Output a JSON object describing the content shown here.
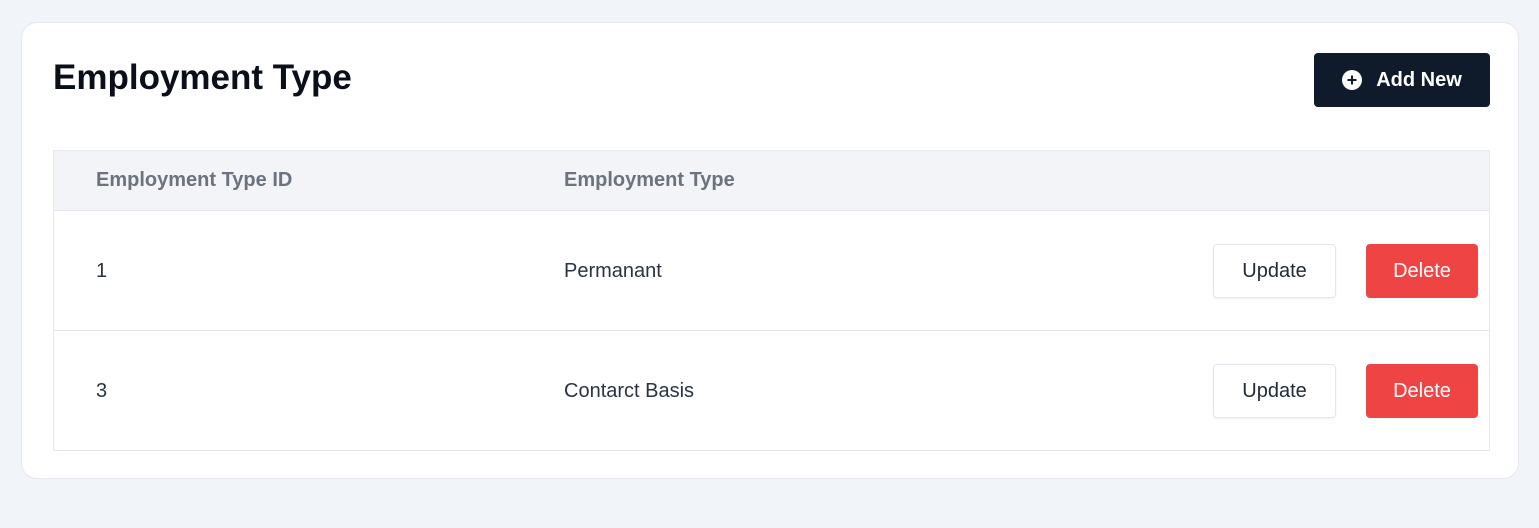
{
  "page": {
    "title": "Employment Type",
    "add_button_label": "Add New",
    "add_button_icon": "plus-circle-icon"
  },
  "colors": {
    "background": "#f1f4f8",
    "primary_button": "#0f1b2a",
    "delete_button": "#ef4444",
    "header_bg": "#f3f4f7"
  },
  "table": {
    "columns": [
      "Employment Type ID",
      "Employment Type"
    ],
    "rows": [
      {
        "id": "1",
        "type": "Permanant",
        "update_label": "Update",
        "delete_label": "Delete"
      },
      {
        "id": "3",
        "type": "Contarct Basis",
        "update_label": "Update",
        "delete_label": "Delete"
      }
    ]
  }
}
